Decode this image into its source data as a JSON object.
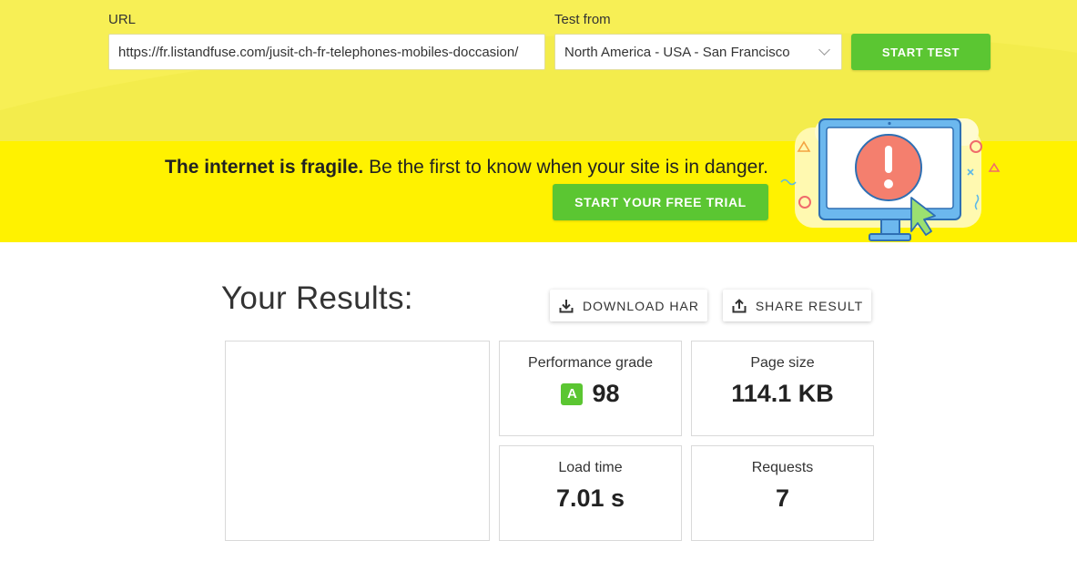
{
  "form": {
    "url_label": "URL",
    "url_value": "https://fr.listandfuse.com/jusit-ch-fr-telephones-mobiles-doccasion/",
    "from_label": "Test from",
    "from_value": "North America - USA - San Francisco",
    "start_label": "START TEST"
  },
  "promo": {
    "bold": "The internet is fragile.",
    "text": " Be the first to know when your site is in danger.",
    "cta": "START YOUR FREE TRIAL",
    "illustration_icon": "monitor-alert-icon"
  },
  "results": {
    "title": "Your Results:",
    "download_label": "DOWNLOAD HAR",
    "share_label": "SHARE RESULT",
    "performance_label": "Performance grade",
    "performance_grade": "A",
    "performance_score": "98",
    "page_size_label": "Page size",
    "page_size_value": "114.1 KB",
    "load_time_label": "Load time",
    "load_time_value": "7.01 s",
    "requests_label": "Requests",
    "requests_value": "7"
  },
  "colors": {
    "top_band": "#f7ef55",
    "promo_band": "#fff200",
    "accent_green": "#5bc632"
  }
}
